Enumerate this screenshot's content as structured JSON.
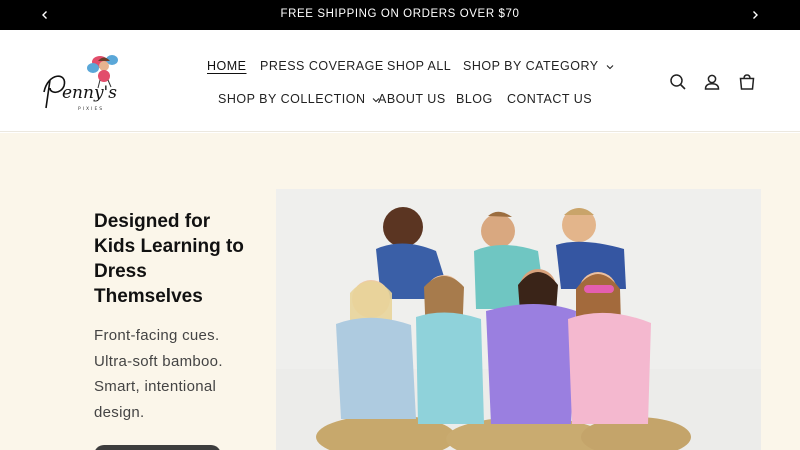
{
  "announcement": {
    "text": "FREE SHIPPING ON ORDERS OVER $70",
    "prev_icon": "chevron-left-icon",
    "next_icon": "chevron-right-icon"
  },
  "header": {
    "logo_text": "Penny's Pixies",
    "nav": [
      {
        "label": "HOME",
        "active": true
      },
      {
        "label": "PRESS COVERAGE"
      },
      {
        "label": "SHOP ALL"
      },
      {
        "label": "SHOP BY CATEGORY",
        "dropdown": true
      },
      {
        "label": "SHOP BY COLLECTION",
        "dropdown": true
      },
      {
        "label": "ABOUT US"
      },
      {
        "label": "BLOG"
      },
      {
        "label": "CONTACT US"
      }
    ],
    "icons": [
      "search-icon",
      "account-icon",
      "cart-icon"
    ]
  },
  "hero": {
    "heading": "Designed for Kids Learning to Dress Themselves",
    "subtext": "Front-facing cues. Ultra-soft bamboo. Smart, intentional design.",
    "background": "#fbf6ea",
    "image_alt": "Group of kids wearing colorful bamboo pajamas"
  }
}
